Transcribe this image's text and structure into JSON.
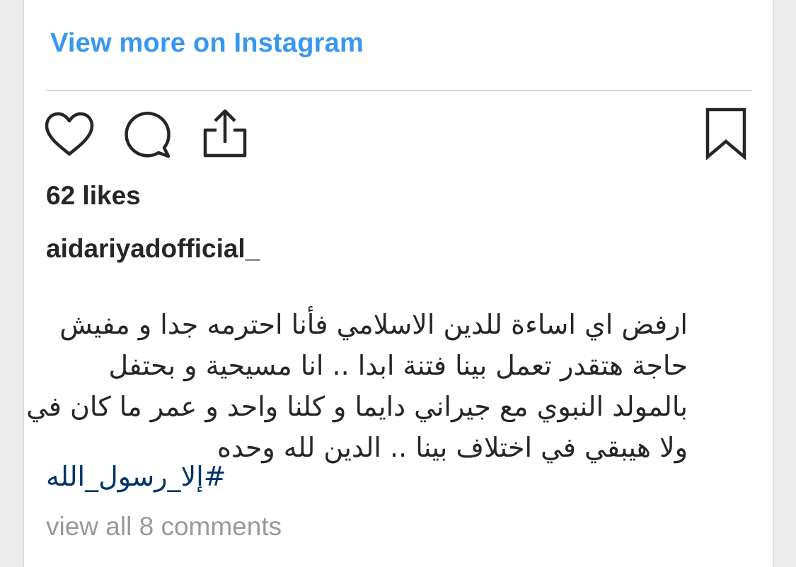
{
  "header": {
    "view_more_label": "View more on Instagram"
  },
  "actions": {
    "like_icon": "heart-icon",
    "comment_icon": "comment-icon",
    "share_icon": "share-icon",
    "save_icon": "bookmark-icon"
  },
  "post": {
    "likes_text": "62 likes",
    "username": "aidariyadofficial_",
    "caption_lines": [
      "ارفض اي اساءة للدين الاسلامي فأنا احترمه جدا و مفيش",
      "حاجة هتقدر تعمل بينا فتنة ابدا .. انا مسيحية و بحتفل",
      "بالمولد النبوي مع جيراني دايما و كلنا واحد و عمر ما كان في",
      "ولا هيبقي في اختلاف بينا .. الدين لله وحده"
    ],
    "hashtag": "#إلا_رسول_الله",
    "comments_link": "view all 8 comments"
  },
  "colors": {
    "link_blue": "#3897f0",
    "hashtag_blue": "#003569",
    "text": "#262626",
    "muted": "#999999"
  }
}
